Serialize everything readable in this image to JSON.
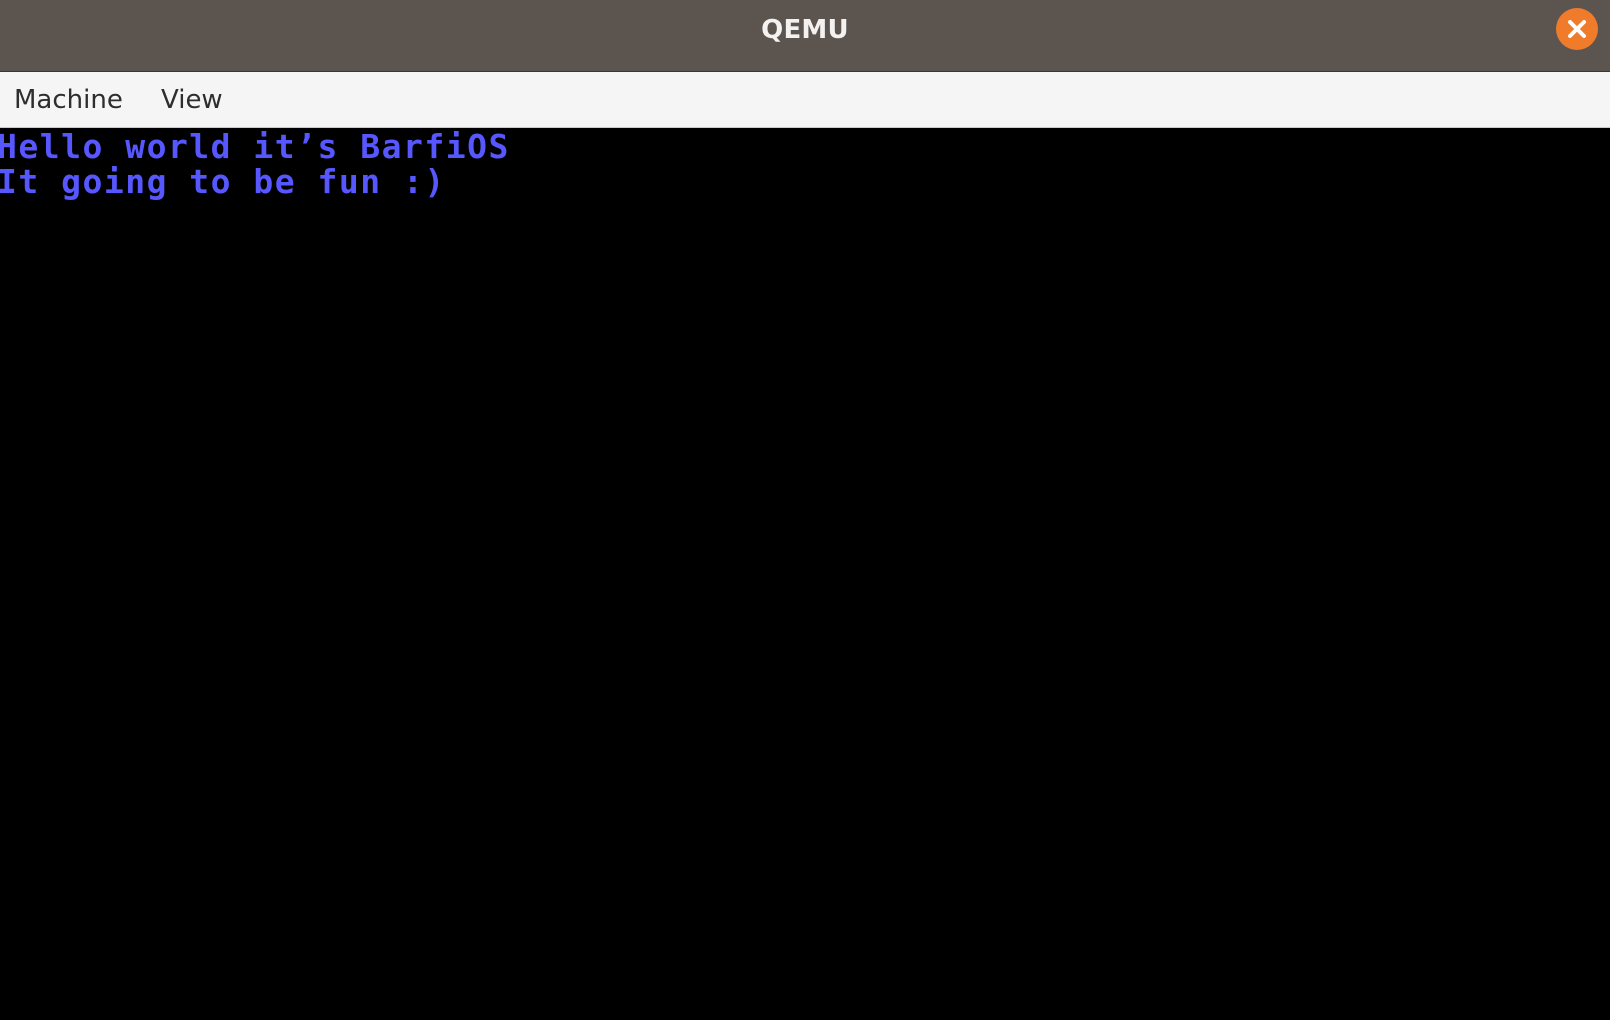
{
  "window": {
    "title": "QEMU"
  },
  "titlebar": {
    "close_icon": "close-icon",
    "close_color": "#ef7b2b",
    "background": "#5c544f"
  },
  "menubar": {
    "items": [
      {
        "label": "Machine"
      },
      {
        "label": "View"
      }
    ]
  },
  "console": {
    "text_color": "#5757ff",
    "background": "#000000",
    "lines": [
      "Hello world it’s BarfiOS",
      "It going to be fun :)"
    ]
  }
}
